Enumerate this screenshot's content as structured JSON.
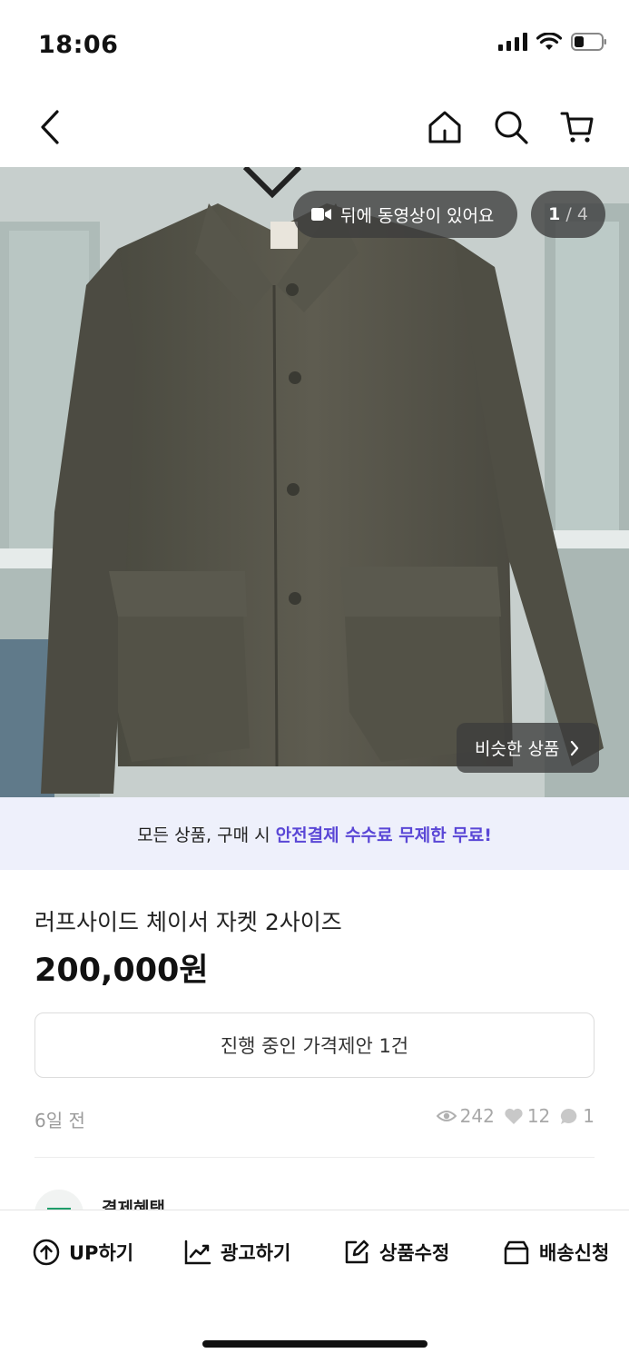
{
  "status_bar": {
    "time": "18:06"
  },
  "nav": {
    "back_icon": "chevron-left-icon",
    "home_icon": "home-icon",
    "search_icon": "search-icon",
    "cart_icon": "cart-icon"
  },
  "image": {
    "video_notice": "뒤에 동영상이 있어요",
    "page_current": "1",
    "page_separator": " / ",
    "page_total": "4",
    "similar_button": "비슷한 상품"
  },
  "promo": {
    "prefix": "모든 상품, 구매 시 ",
    "highlight": "안전결제 수수료 무제한 무료!"
  },
  "product": {
    "title": "러프사이드 체이서 자켓 2사이즈",
    "price": "200,000원",
    "offer_button": "진행 중인 가격제안 1건",
    "time_ago": "6일 전",
    "views": "242",
    "likes": "12",
    "chats": "1"
  },
  "benefit": {
    "label": "결제혜택"
  },
  "actions": [
    {
      "label": "UP하기",
      "icon": "arrow-up-circle-icon"
    },
    {
      "label": "광고하기",
      "icon": "trend-chart-icon"
    },
    {
      "label": "상품수정",
      "icon": "edit-icon"
    },
    {
      "label": "배송신청",
      "icon": "box-icon"
    }
  ],
  "colors": {
    "accent": "#5a47d6",
    "promo_bg": "#eef0fb"
  }
}
